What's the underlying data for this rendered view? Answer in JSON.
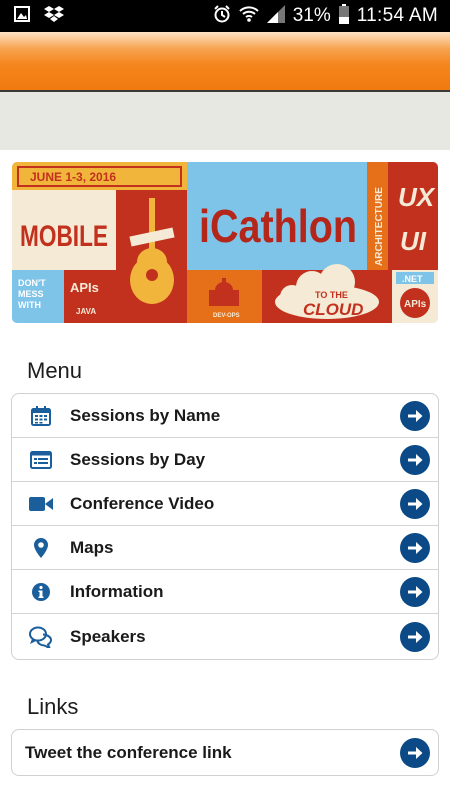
{
  "status_bar": {
    "battery_percent": "31%",
    "time": "11:54 AM",
    "left_icons": [
      "gallery-icon",
      "dropbox-icon"
    ],
    "right_icons": [
      "alarm-icon",
      "wifi-icon",
      "signal-icon",
      "battery-icon"
    ]
  },
  "colors": {
    "header_orange": "#f5861e",
    "arrow_blue": "#0b4a86",
    "icon_blue": "#1a5e9c"
  },
  "banner": {
    "date": "JUNE 1-3, 2016",
    "mobile": "MOBILE",
    "title": "iCathlon",
    "architecture": "ARCHITECTURE",
    "ux": "UX",
    "ui": "UI",
    "dont_mess": [
      "DON'T",
      "MESS",
      "WITH"
    ],
    "apis": "APIs",
    "java": "JAVA",
    "dev_ops": "DEV-OPS",
    "to_the": "TO THE",
    "cloud": "CLOUD",
    "net": ".NET",
    "apis_badge": "APIs"
  },
  "menu": {
    "title": "Menu",
    "items": [
      {
        "label": "Sessions by Name",
        "icon": "calendar-icon"
      },
      {
        "label": "Sessions by Day",
        "icon": "list-icon"
      },
      {
        "label": "Conference Video",
        "icon": "video-camera-icon"
      },
      {
        "label": "Maps",
        "icon": "map-pin-icon"
      },
      {
        "label": "Information",
        "icon": "info-icon"
      },
      {
        "label": "Speakers",
        "icon": "chat-bubbles-icon"
      }
    ]
  },
  "links": {
    "title": "Links",
    "items": [
      {
        "label": "Tweet the conference link"
      }
    ]
  }
}
